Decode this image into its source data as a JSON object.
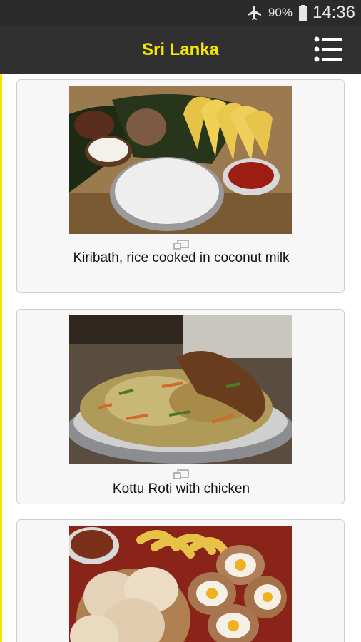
{
  "status_bar": {
    "icons": [
      "airplane-mode-icon",
      "battery-icon"
    ],
    "battery_percent": "90%",
    "time": "14:36"
  },
  "app_bar": {
    "title": "Sri Lanka",
    "menu_icon": "list-menu-icon"
  },
  "colors": {
    "accent": "#f5e600",
    "app_bar": "#303030",
    "status_bar": "#2b2b2b"
  },
  "cards": [
    {
      "caption": "Kiribath, rice cooked in coconut milk",
      "image": "kiribath-photo"
    },
    {
      "caption": "Kottu Roti with chicken",
      "image": "kottu-roti-photo"
    },
    {
      "caption": "",
      "image": "hoppers-photo"
    }
  ]
}
